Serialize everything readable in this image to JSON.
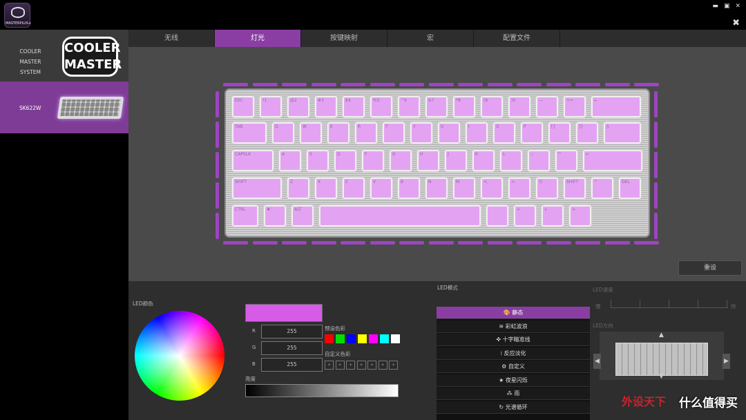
{
  "app": {
    "logo_text": "MASTERPLUS+"
  },
  "sidebar": {
    "system_label": "COOLER MASTER SYSTEM",
    "logo_text": "COOLER MASTER",
    "device_label": "SK622W"
  },
  "tabs": [
    {
      "label": "无线"
    },
    {
      "label": "灯光",
      "active": true
    },
    {
      "label": "按键映射"
    },
    {
      "label": "宏"
    },
    {
      "label": "配置文件"
    }
  ],
  "reset_label": "重设",
  "led_color": {
    "title": "LED颜色",
    "r": "255",
    "g": "255",
    "b": "255",
    "r_label": "R",
    "g_label": "G",
    "b_label": "B",
    "preset_label": "预设色彩",
    "custom_label": "自定义色彩",
    "brightness_label": "亮度",
    "current_color": "#d65ce8",
    "presets": [
      "#ff0000",
      "#00dd00",
      "#0000ff",
      "#ffff00",
      "#ff00ff",
      "#00ffff",
      "#ffffff"
    ]
  },
  "led_mode": {
    "title": "LED模式",
    "items": [
      {
        "icon": "palette-icon",
        "label": "静态",
        "active": true
      },
      {
        "icon": "rainbow-icon",
        "label": "彩虹波浪"
      },
      {
        "icon": "crosshair-icon",
        "label": "十字瞄准线"
      },
      {
        "icon": "reactive-icon",
        "label": "反应淡化"
      },
      {
        "icon": "gear-icon",
        "label": "自定义"
      },
      {
        "icon": "star-icon",
        "label": "夜星闪烁"
      },
      {
        "icon": "rain-icon",
        "label": "雨"
      },
      {
        "icon": "swirl-icon",
        "label": "光谱循环"
      }
    ]
  },
  "led_speed": {
    "title": "LED速度",
    "slow": "慢",
    "fast": "快"
  },
  "led_direction": {
    "title": "LED方向"
  },
  "watermark": {
    "text": "什么值得买",
    "sub": "外设天下"
  },
  "keyboard": {
    "rows": [
      [
        "ESC",
        "!1",
        "@2",
        "#3",
        "$4",
        "%5",
        "^6",
        "&7",
        "*8",
        "(9",
        ")0",
        "—",
        "+=",
        "←"
      ],
      [
        "TAB",
        "Q",
        "W",
        "E",
        "R",
        "T",
        "Y",
        "U",
        "I",
        "O",
        "P",
        "[{",
        "]}",
        "|\\"
      ],
      [
        "CAPSLK",
        "A",
        "S",
        "D",
        "F",
        "G",
        "H",
        "J",
        "K",
        "L",
        ":;",
        "\"'",
        "↵"
      ],
      [
        "SHIFT",
        "Z",
        "X",
        "C",
        "V",
        "B",
        "N",
        "M",
        "<,",
        ">.",
        "?/",
        "SHIFT",
        "^",
        "DEL"
      ],
      [
        "CTRL",
        "❖",
        "ALT",
        "",
        "",
        "<",
        "∨",
        ">"
      ]
    ]
  }
}
